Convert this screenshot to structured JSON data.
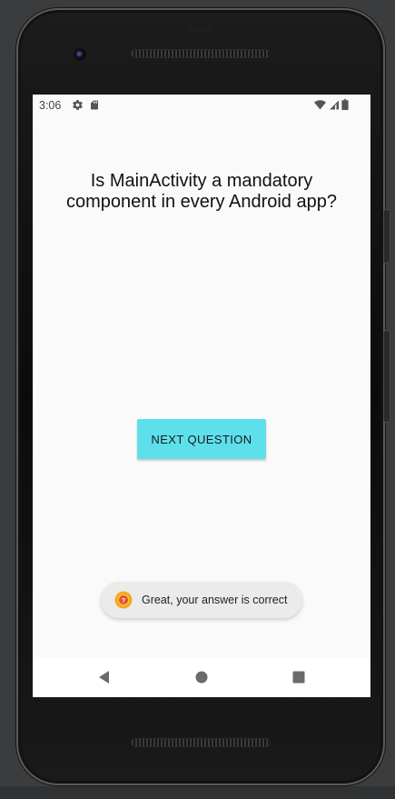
{
  "status_bar": {
    "time": "3:06",
    "left_icons": [
      "gear-icon",
      "sd-card-icon"
    ],
    "right_icons": [
      "wifi-icon",
      "cell-signal-icon",
      "battery-icon"
    ]
  },
  "main": {
    "question": "Is MainActivity a mandatory component in every Android app?",
    "next_button_label": "NEXT QUESTION"
  },
  "toast": {
    "icon": "app-icon",
    "message": "Great, your answer is correct"
  },
  "nav_bar": {
    "buttons": [
      "back-icon",
      "home-icon",
      "recents-icon"
    ]
  },
  "colors": {
    "accent_button": "#5ee0ec",
    "screen_bg": "#fafafa",
    "toast_bg": "#ebebeb"
  }
}
